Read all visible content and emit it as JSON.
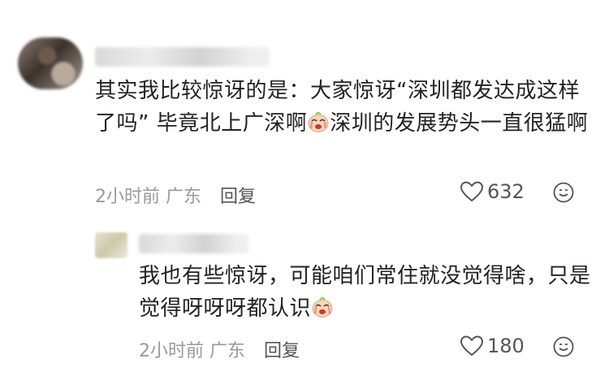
{
  "main_comment": {
    "text_part1": "其实我比较惊讶的是：大家惊讶“深圳都发达成这样了吗” 毕竟北上广深啊",
    "text_part2": "深圳的发展势头一直很猛啊",
    "inline_emoji": "crying-face-emoji",
    "time": "2小时前",
    "location": "广东",
    "reply_label": "回复",
    "likes": "632"
  },
  "reply_comment": {
    "text": "我也有些惊讶，可能咱们常住就没觉得啥，只是觉得呀呀呀都认识",
    "inline_emoji": "crying-face-emoji",
    "time": "2小时前",
    "location": "广东",
    "reply_label": "回复",
    "likes": "180"
  },
  "colors": {
    "text": "#222222",
    "meta": "#9a9a9a",
    "reply": "#555555",
    "emoji_face": "#f7d6b8",
    "emoji_tear": "#ff8a8a"
  },
  "icons": [
    "heart-outline-icon",
    "smiley-face-icon"
  ]
}
